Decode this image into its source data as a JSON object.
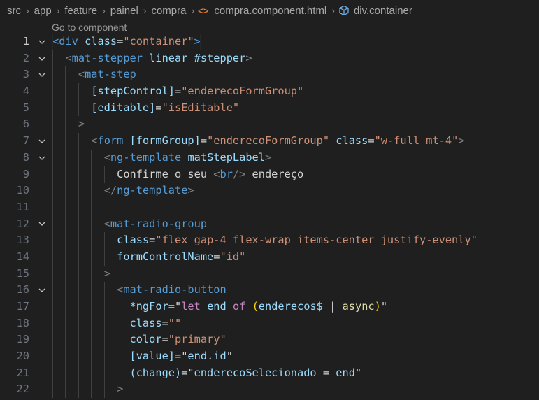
{
  "breadcrumb": {
    "parts": [
      "src",
      "app",
      "feature",
      "painel",
      "compra"
    ],
    "file": "compra.component.html",
    "symbol": "div.container"
  },
  "codelens": "Go to component",
  "colors": {
    "background": "#1f1f1f",
    "tag": "#569cd6",
    "attribute": "#9cdcfe",
    "string": "#ce9178",
    "punctuation": "#808080",
    "text": "#d4d4d4",
    "keyword": "#c586c0",
    "icon_code": "#e37933"
  },
  "icons": {
    "fold_open": "chevron-down-icon",
    "fold_closed": "chevron-right-icon",
    "file": "code-brackets-icon",
    "symbol": "cube-icon"
  },
  "lines": [
    {
      "n": "1",
      "fold": true,
      "indent": 0,
      "tokens": [
        [
          "tag",
          "<div"
        ],
        [
          "sp",
          " "
        ],
        [
          "attr",
          "class"
        ],
        [
          "op",
          "="
        ],
        [
          "str",
          "\"container\""
        ],
        [
          "tag",
          ">"
        ]
      ]
    },
    {
      "n": "2",
      "fold": true,
      "indent": 1,
      "tokens": [
        [
          "punct",
          "<"
        ],
        [
          "tag",
          "mat-stepper"
        ],
        [
          "sp",
          " "
        ],
        [
          "attr",
          "linear"
        ],
        [
          "sp",
          " "
        ],
        [
          "attr",
          "#stepper"
        ],
        [
          "punct",
          ">"
        ]
      ]
    },
    {
      "n": "3",
      "fold": true,
      "indent": 2,
      "tokens": [
        [
          "punct",
          "<"
        ],
        [
          "tag",
          "mat-step"
        ]
      ]
    },
    {
      "n": "4",
      "fold": false,
      "indent": 3,
      "tokens": [
        [
          "attr",
          "[stepControl]"
        ],
        [
          "op",
          "="
        ],
        [
          "str",
          "\"enderecoFormGroup\""
        ]
      ]
    },
    {
      "n": "5",
      "fold": false,
      "indent": 3,
      "tokens": [
        [
          "attr",
          "[editable]"
        ],
        [
          "op",
          "="
        ],
        [
          "str",
          "\"isEditable\""
        ]
      ]
    },
    {
      "n": "6",
      "fold": false,
      "indent": 2,
      "tokens": [
        [
          "punct",
          ">"
        ]
      ]
    },
    {
      "n": "7",
      "fold": true,
      "indent": 3,
      "tokens": [
        [
          "punct",
          "<"
        ],
        [
          "tag",
          "form"
        ],
        [
          "sp",
          " "
        ],
        [
          "attr",
          "[formGroup]"
        ],
        [
          "op",
          "="
        ],
        [
          "str",
          "\"enderecoFormGroup\""
        ],
        [
          "sp",
          " "
        ],
        [
          "attr",
          "class"
        ],
        [
          "op",
          "="
        ],
        [
          "str",
          "\"w-full mt-4\""
        ],
        [
          "punct",
          ">"
        ]
      ]
    },
    {
      "n": "8",
      "fold": true,
      "indent": 4,
      "tokens": [
        [
          "punct",
          "<"
        ],
        [
          "tag",
          "ng-template"
        ],
        [
          "sp",
          " "
        ],
        [
          "attr",
          "matStepLabel"
        ],
        [
          "punct",
          ">"
        ]
      ]
    },
    {
      "n": "9",
      "fold": false,
      "indent": 5,
      "tokens": [
        [
          "text",
          "Confirme o seu "
        ],
        [
          "punct",
          "<"
        ],
        [
          "tag",
          "br"
        ],
        [
          "punct",
          "/>"
        ],
        [
          "text",
          " endereço"
        ]
      ]
    },
    {
      "n": "10",
      "fold": false,
      "indent": 4,
      "tokens": [
        [
          "punct",
          "</"
        ],
        [
          "tag",
          "ng-template"
        ],
        [
          "punct",
          ">"
        ]
      ]
    },
    {
      "n": "11",
      "fold": false,
      "indent": 4,
      "tokens": []
    },
    {
      "n": "12",
      "fold": true,
      "indent": 4,
      "tokens": [
        [
          "punct",
          "<"
        ],
        [
          "tag",
          "mat-radio-group"
        ]
      ]
    },
    {
      "n": "13",
      "fold": false,
      "indent": 5,
      "tokens": [
        [
          "attr",
          "class"
        ],
        [
          "op",
          "="
        ],
        [
          "str",
          "\"flex gap-4 flex-wrap items-center justify-evenly\""
        ]
      ]
    },
    {
      "n": "14",
      "fold": false,
      "indent": 5,
      "tokens": [
        [
          "attr",
          "formControlName"
        ],
        [
          "op",
          "="
        ],
        [
          "str",
          "\"id\""
        ]
      ]
    },
    {
      "n": "15",
      "fold": false,
      "indent": 4,
      "tokens": [
        [
          "punct",
          ">"
        ]
      ]
    },
    {
      "n": "16",
      "fold": true,
      "indent": 5,
      "tokens": [
        [
          "punct",
          "<"
        ],
        [
          "tag",
          "mat-radio-button"
        ]
      ]
    },
    {
      "n": "17",
      "fold": false,
      "indent": 6,
      "tokens": [
        [
          "attr",
          "*ngFor"
        ],
        [
          "op",
          "="
        ],
        [
          "text",
          "\""
        ],
        [
          "kw",
          "let"
        ],
        [
          "sp",
          " "
        ],
        [
          "var",
          "end"
        ],
        [
          "sp",
          " "
        ],
        [
          "kw",
          "of"
        ],
        [
          "sp",
          " "
        ],
        [
          "p1",
          "("
        ],
        [
          "var",
          "enderecos$"
        ],
        [
          "sp",
          " "
        ],
        [
          "op",
          "|"
        ],
        [
          "sp",
          " "
        ],
        [
          "fn",
          "async"
        ],
        [
          "p1",
          ")"
        ],
        [
          "text",
          "\""
        ]
      ]
    },
    {
      "n": "18",
      "fold": false,
      "indent": 6,
      "tokens": [
        [
          "attr",
          "class"
        ],
        [
          "op",
          "="
        ],
        [
          "str",
          "\"\""
        ]
      ]
    },
    {
      "n": "19",
      "fold": false,
      "indent": 6,
      "tokens": [
        [
          "attr",
          "color"
        ],
        [
          "op",
          "="
        ],
        [
          "str",
          "\"primary\""
        ]
      ]
    },
    {
      "n": "20",
      "fold": false,
      "indent": 6,
      "tokens": [
        [
          "attr",
          "[value]"
        ],
        [
          "op",
          "="
        ],
        [
          "text",
          "\""
        ],
        [
          "var",
          "end"
        ],
        [
          "op",
          "."
        ],
        [
          "var",
          "id"
        ],
        [
          "text",
          "\""
        ]
      ]
    },
    {
      "n": "21",
      "fold": false,
      "indent": 6,
      "tokens": [
        [
          "attr",
          "(change)"
        ],
        [
          "op",
          "="
        ],
        [
          "text",
          "\""
        ],
        [
          "var",
          "enderecoSelecionado"
        ],
        [
          "sp",
          " "
        ],
        [
          "op",
          "="
        ],
        [
          "sp",
          " "
        ],
        [
          "var",
          "end"
        ],
        [
          "text",
          "\""
        ]
      ]
    },
    {
      "n": "22",
      "fold": false,
      "indent": 5,
      "tokens": [
        [
          "punct",
          ">"
        ]
      ]
    }
  ]
}
